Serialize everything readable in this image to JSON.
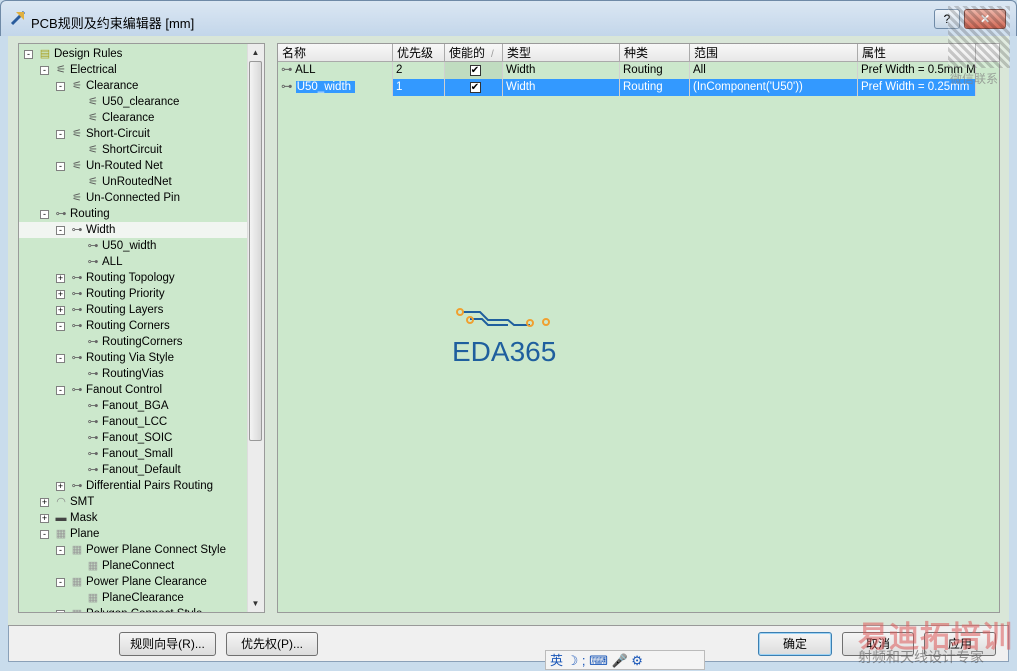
{
  "window": {
    "title": "PCB规则及约束编辑器 [mm]",
    "close": "✕",
    "minimize": "?"
  },
  "tree": [
    {
      "label": "Design Rules",
      "level": 0,
      "exp": "-",
      "icon": "folder"
    },
    {
      "label": "Electrical",
      "level": 1,
      "exp": "-",
      "icon": "electrical"
    },
    {
      "label": "Clearance",
      "level": 2,
      "exp": "-",
      "icon": "electrical"
    },
    {
      "label": "U50_clearance",
      "level": 3,
      "exp": "",
      "icon": "electrical"
    },
    {
      "label": "Clearance",
      "level": 3,
      "exp": "",
      "icon": "electrical"
    },
    {
      "label": "Short-Circuit",
      "level": 2,
      "exp": "-",
      "icon": "electrical"
    },
    {
      "label": "ShortCircuit",
      "level": 3,
      "exp": "",
      "icon": "electrical"
    },
    {
      "label": "Un-Routed Net",
      "level": 2,
      "exp": "-",
      "icon": "electrical"
    },
    {
      "label": "UnRoutedNet",
      "level": 3,
      "exp": "",
      "icon": "electrical"
    },
    {
      "label": "Un-Connected Pin",
      "level": 2,
      "exp": "",
      "icon": "electrical"
    },
    {
      "label": "Routing",
      "level": 1,
      "exp": "-",
      "icon": "routing"
    },
    {
      "label": "Width",
      "level": 2,
      "exp": "-",
      "icon": "routing",
      "selected": true
    },
    {
      "label": "U50_width",
      "level": 3,
      "exp": "",
      "icon": "routing"
    },
    {
      "label": "ALL",
      "level": 3,
      "exp": "",
      "icon": "routing"
    },
    {
      "label": "Routing Topology",
      "level": 2,
      "exp": "+",
      "icon": "routing"
    },
    {
      "label": "Routing Priority",
      "level": 2,
      "exp": "+",
      "icon": "routing"
    },
    {
      "label": "Routing Layers",
      "level": 2,
      "exp": "+",
      "icon": "routing"
    },
    {
      "label": "Routing Corners",
      "level": 2,
      "exp": "-",
      "icon": "routing"
    },
    {
      "label": "RoutingCorners",
      "level": 3,
      "exp": "",
      "icon": "routing"
    },
    {
      "label": "Routing Via Style",
      "level": 2,
      "exp": "-",
      "icon": "routing"
    },
    {
      "label": "RoutingVias",
      "level": 3,
      "exp": "",
      "icon": "routing"
    },
    {
      "label": "Fanout Control",
      "level": 2,
      "exp": "-",
      "icon": "routing"
    },
    {
      "label": "Fanout_BGA",
      "level": 3,
      "exp": "",
      "icon": "routing"
    },
    {
      "label": "Fanout_LCC",
      "level": 3,
      "exp": "",
      "icon": "routing"
    },
    {
      "label": "Fanout_SOIC",
      "level": 3,
      "exp": "",
      "icon": "routing"
    },
    {
      "label": "Fanout_Small",
      "level": 3,
      "exp": "",
      "icon": "routing"
    },
    {
      "label": "Fanout_Default",
      "level": 3,
      "exp": "",
      "icon": "routing"
    },
    {
      "label": "Differential Pairs Routing",
      "level": 2,
      "exp": "+",
      "icon": "routing"
    },
    {
      "label": "SMT",
      "level": 1,
      "exp": "+",
      "icon": "smt"
    },
    {
      "label": "Mask",
      "level": 1,
      "exp": "+",
      "icon": "mask"
    },
    {
      "label": "Plane",
      "level": 1,
      "exp": "-",
      "icon": "plane"
    },
    {
      "label": "Power Plane Connect Style",
      "level": 2,
      "exp": "-",
      "icon": "plane"
    },
    {
      "label": "PlaneConnect",
      "level": 3,
      "exp": "",
      "icon": "plane"
    },
    {
      "label": "Power Plane Clearance",
      "level": 2,
      "exp": "-",
      "icon": "plane"
    },
    {
      "label": "PlaneClearance",
      "level": 3,
      "exp": "",
      "icon": "plane"
    },
    {
      "label": "Polygon Connect Style",
      "level": 2,
      "exp": "-",
      "icon": "plane"
    }
  ],
  "grid": {
    "columns": [
      "名称",
      "优先级",
      "使能的",
      "类型",
      "种类",
      "范围",
      "属性"
    ],
    "sort_indicator": "/",
    "rows": [
      {
        "name": "ALL",
        "priority": "2",
        "enabled": true,
        "type": "Width",
        "kind": "Routing",
        "scope": "All",
        "attributes": "Pref Width = 0.5mm   M",
        "selected": false
      },
      {
        "name": "U50_width",
        "priority": "1",
        "enabled": true,
        "type": "Width",
        "kind": "Routing",
        "scope": "(InComponent('U50'))",
        "attributes": "Pref Width = 0.25mm",
        "selected": true
      }
    ]
  },
  "logo": {
    "text": "EDA365",
    "color": "#1f5f9e",
    "accent": "#f0a030"
  },
  "buttons": {
    "wizard": "规则向导(R)...",
    "priority": "优先权(P)...",
    "ok": "确定",
    "cancel": "取消",
    "apply": "应用"
  },
  "ime": {
    "text": "英 ☽ ; ⌨ 🎤 ⚙"
  },
  "watermarks": {
    "brand": "易迪拓培训",
    "tagline": "射频和天线设计专家",
    "contact": "微信联系"
  }
}
